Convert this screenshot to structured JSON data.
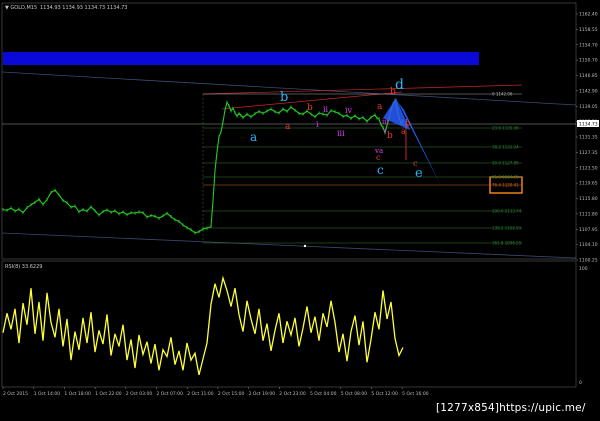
{
  "window": {
    "symbol_caption": "▼ GOLD,M15",
    "ohlc_caption": "1134.93 1134.93 1134.73 1134.73"
  },
  "indicator": {
    "caption": "RSI(8) 33.6229",
    "top_value": "100",
    "bottom_value": "0"
  },
  "price_axis_labels": [
    "1162.40",
    "1158.55",
    "1154.70",
    "1150.70",
    "1146.85",
    "1142.90",
    "1139.05",
    "1135.20",
    "1131.35",
    "1127.35",
    "1123.50",
    "1119.65",
    "1115.80",
    "1111.80",
    "1107.95",
    "1104.10",
    "1100.25"
  ],
  "last_price_tag": "1134.73",
  "time_axis_labels": [
    "2 Oct 2015",
    "1 Oct 14:00",
    "1 Oct 18:00",
    "1 Oct 22:00",
    "2 Oct 03:00",
    "2 Oct 07:00",
    "2 Oct 11:00",
    "2 Oct 15:00",
    "2 Oct 19:00",
    "2 Oct 23:00",
    "5 Oct 04:00",
    "5 Oct 08:00",
    "5 Oct 12:00",
    "5 Oct 16:00"
  ],
  "fib_levels": [
    {
      "label": "0  1142.06",
      "color": "#a7a7a7"
    },
    {
      "label": "23.6  1135.38",
      "color": "#2e7d32"
    },
    {
      "label": "38.2  1131.24",
      "color": "#2e7d32"
    },
    {
      "label": "50.0  1127.89",
      "color": "#2e7d32"
    },
    {
      "label": "61.8  1124.55",
      "color": "#2e7d32"
    },
    {
      "label": "76.4  1120.41",
      "color": "#d1661e"
    },
    {
      "label": "100.0  1113.74",
      "color": "#2e7d32"
    },
    {
      "label": "138.2  1102.93",
      "color": "#2e7d32"
    },
    {
      "label": "161.8  1096.25",
      "color": "#2e7d32"
    }
  ],
  "wave_labels": [
    {
      "text": "a",
      "color": "#29b6f6"
    },
    {
      "text": "b",
      "color": "#29b6f6"
    },
    {
      "text": "a",
      "color": "#e53935"
    },
    {
      "text": "b",
      "color": "#e53935"
    },
    {
      "text": "i",
      "color": "#e040fb"
    },
    {
      "text": "ii",
      "color": "#e040fb"
    },
    {
      "text": "iii",
      "color": "#e040fb"
    },
    {
      "text": "iv",
      "color": "#e040fb"
    },
    {
      "text": "a",
      "color": "#e53935"
    },
    {
      "text": "b",
      "color": "#e53935"
    },
    {
      "text": "d",
      "color": "#29b6f6"
    },
    {
      "text": "iii",
      "color": "#e040fb"
    },
    {
      "text": "b",
      "color": "#e53935"
    },
    {
      "text": "v",
      "color": "#e040fb"
    },
    {
      "text": "a",
      "color": "#e53935"
    },
    {
      "text": "b",
      "color": "#e53935"
    },
    {
      "text": "c",
      "color": "#e53935"
    },
    {
      "text": "va",
      "color": "#e040fb"
    },
    {
      "text": "c",
      "color": "#e53935"
    },
    {
      "text": "c",
      "color": "#29b6f6"
    },
    {
      "text": "e",
      "color": "#29b6f6"
    }
  ],
  "watermark": "[1277x854]https://upic.me/",
  "chart_data": {
    "type": "line",
    "series": [
      {
        "name": "GOLD,M15",
        "color": "#22cc22",
        "x": [
          0,
          4,
          8,
          12,
          16,
          20,
          24,
          28,
          32,
          36,
          40,
          44,
          48,
          52,
          56,
          60,
          64,
          68,
          72,
          76,
          80,
          84,
          88,
          92,
          96,
          100,
          104,
          108,
          112,
          116,
          120,
          124,
          128,
          132,
          136,
          140,
          144,
          148,
          152,
          156,
          160,
          164,
          168,
          172,
          176,
          180,
          184,
          188,
          192,
          196,
          200,
          204,
          208,
          210,
          212,
          214,
          216,
          218,
          220,
          222,
          224,
          226,
          228,
          230,
          232,
          234,
          236,
          238,
          240,
          244,
          248,
          252,
          256,
          260,
          264,
          268,
          272,
          276,
          280,
          284,
          288,
          292,
          296,
          300,
          304,
          308,
          312,
          316,
          320,
          324,
          328,
          332,
          336,
          340,
          344,
          348,
          352,
          356,
          360,
          364,
          368,
          372,
          374,
          376,
          378,
          380,
          382,
          384,
          386,
          388,
          390,
          392,
          394,
          396,
          398,
          400
        ],
        "y": [
          1113.0,
          1112.8,
          1113.4,
          1112.6,
          1113.1,
          1112.2,
          1113.5,
          1114.2,
          1114.8,
          1115.6,
          1114.3,
          1115.5,
          1117.3,
          1117.9,
          1116.7,
          1115.3,
          1114.7,
          1113.6,
          1113.9,
          1112.4,
          1113.0,
          1112.6,
          1113.7,
          1112.7,
          1111.6,
          1112.5,
          1112.9,
          1112.3,
          1112.7,
          1111.9,
          1112.4,
          1111.7,
          1112.2,
          1112.1,
          1112.4,
          1112.2,
          1111.1,
          1111.5,
          1111.3,
          1110.8,
          1111.4,
          1112.1,
          1111.2,
          1110.4,
          1110.0,
          1109.1,
          1108.4,
          1107.9,
          1107.1,
          1107.4,
          1108.1,
          1108.3,
          1108.7,
          1115.2,
          1122.8,
          1127.5,
          1131.4,
          1132.6,
          1135.2,
          1138.1,
          1140.1,
          1139.2,
          1137.9,
          1138.6,
          1137.4,
          1136.6,
          1137.3,
          1136.8,
          1136.2,
          1137.1,
          1136.4,
          1137.2,
          1137.8,
          1137.3,
          1137.9,
          1138.4,
          1137.7,
          1137.4,
          1138.4,
          1137.8,
          1138.9,
          1138.1,
          1137.3,
          1137.1,
          1137.9,
          1137.1,
          1136.4,
          1137.4,
          1137.1,
          1136.8,
          1138.0,
          1137.7,
          1137.3,
          1136.5,
          1136.8,
          1136.0,
          1136.7,
          1135.9,
          1136.3,
          1135.3,
          1136.3,
          1136.9,
          1136.1,
          1135.9,
          1134.5,
          1133.7,
          1132.4,
          1134.3,
          1135.9,
          1138.1,
          1139.7,
          1140.6,
          1138.2,
          1136.3,
          1134.8,
          1135.4
        ]
      },
      {
        "name": "RSI(8)",
        "color": "#ffff3c",
        "x": [
          0,
          4,
          8,
          12,
          16,
          20,
          24,
          28,
          32,
          36,
          40,
          44,
          48,
          52,
          56,
          60,
          64,
          68,
          72,
          76,
          80,
          84,
          88,
          92,
          96,
          100,
          104,
          108,
          112,
          116,
          120,
          124,
          128,
          132,
          136,
          140,
          144,
          148,
          152,
          156,
          160,
          164,
          168,
          172,
          176,
          180,
          184,
          188,
          192,
          196,
          200,
          204,
          208,
          212,
          216,
          220,
          224,
          228,
          232,
          236,
          240,
          244,
          248,
          252,
          256,
          260,
          264,
          268,
          272,
          276,
          280,
          284,
          288,
          292,
          296,
          300,
          304,
          308,
          312,
          316,
          320,
          324,
          328,
          332,
          336,
          340,
          344,
          348,
          352,
          356,
          360,
          364,
          368,
          372,
          376,
          380,
          384,
          388,
          392,
          396,
          400
        ],
        "y": [
          45,
          62,
          48,
          66,
          36,
          71,
          52,
          84,
          44,
          72,
          38,
          80,
          54,
          41,
          66,
          33,
          57,
          21,
          46,
          30,
          58,
          36,
          63,
          28,
          47,
          35,
          61,
          25,
          44,
          33,
          52,
          21,
          39,
          14,
          43,
          26,
          37,
          18,
          35,
          12,
          30,
          24,
          41,
          17,
          29,
          12,
          36,
          21,
          27,
          8,
          22,
          36,
          70,
          88,
          76,
          93,
          82,
          68,
          84,
          61,
          46,
          73,
          57,
          44,
          66,
          38,
          53,
          29,
          47,
          62,
          36,
          55,
          43,
          58,
          33,
          49,
          68,
          45,
          59,
          38,
          62,
          50,
          73,
          54,
          28,
          44,
          20,
          46,
          60,
          34,
          55,
          19,
          39,
          63,
          48,
          82,
          57,
          72,
          40,
          25,
          32
        ]
      }
    ],
    "ylim": [
      1100.25,
      1163.2
    ],
    "rsi_ylim": [
      0,
      100
    ],
    "grid": false,
    "legend": "none"
  }
}
